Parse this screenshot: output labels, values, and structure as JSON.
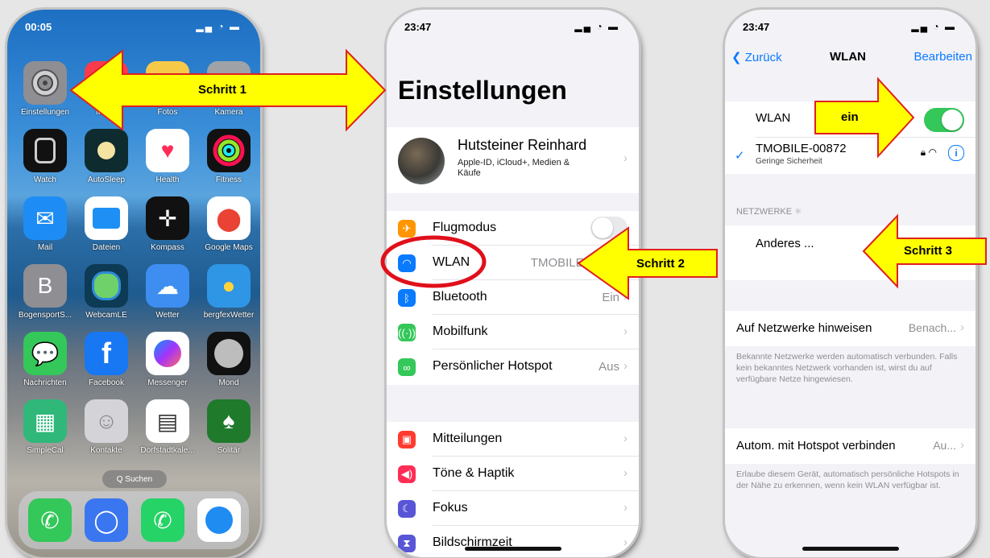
{
  "home": {
    "time": "00:05",
    "apps": [
      {
        "label": "Einstellungen",
        "icon": "settings-icon",
        "color": "#8e8e93"
      },
      {
        "label": "Musik",
        "icon": "music-icon",
        "color": "#fa3b4d"
      },
      {
        "label": "Fotos",
        "icon": "photos-icon",
        "color": "#f7c948"
      },
      {
        "label": "Kamera",
        "icon": "camera-icon",
        "color": "#9fa3a8"
      },
      {
        "label": "Watch",
        "icon": "watch-icon",
        "color": "#111111"
      },
      {
        "label": "AutoSleep",
        "icon": "autosleep-icon",
        "color": "#0e2c30"
      },
      {
        "label": "Health",
        "icon": "health-icon",
        "color": "#ffffff"
      },
      {
        "label": "Fitness",
        "icon": "fitness-icon",
        "color": "#111111"
      },
      {
        "label": "Mail",
        "icon": "mail-icon",
        "color": "#1d8df5"
      },
      {
        "label": "Dateien",
        "icon": "files-icon",
        "color": "#ffffff"
      },
      {
        "label": "Kompass",
        "icon": "compass-icon",
        "color": "#111111"
      },
      {
        "label": "Google Maps",
        "icon": "google-maps-icon",
        "color": "#ffffff"
      },
      {
        "label": "BogensportS...",
        "icon": "bogensport-icon",
        "color": "#8e8e93"
      },
      {
        "label": "WebcamLE",
        "icon": "webcam-icon",
        "color": "#0d3a54"
      },
      {
        "label": "Wetter",
        "icon": "weather-icon",
        "color": "#3d8ef0"
      },
      {
        "label": "bergfexWetter",
        "icon": "bergfex-weather-icon",
        "color": "#2f95e5"
      },
      {
        "label": "Nachrichten",
        "icon": "messages-icon",
        "color": "#34c759"
      },
      {
        "label": "Facebook",
        "icon": "facebook-icon",
        "color": "#1877f2"
      },
      {
        "label": "Messenger",
        "icon": "messenger-icon",
        "color": "#ffffff"
      },
      {
        "label": "Mond",
        "icon": "moon-icon",
        "color": "#111111"
      },
      {
        "label": "SimpleCal",
        "icon": "calendar-icon",
        "color": "#2fb87a"
      },
      {
        "label": "Kontakte",
        "icon": "contacts-icon",
        "color": "#d4d4d8"
      },
      {
        "label": "Dorfstadtkale...",
        "icon": "notes-icon",
        "color": "#ffffff"
      },
      {
        "label": "Solitär",
        "icon": "solitaire-icon",
        "color": "#1f7a2c"
      }
    ],
    "search_label": "Q Suchen",
    "dock": [
      {
        "icon": "phone-icon",
        "color": "#34c759"
      },
      {
        "icon": "signal-icon",
        "color": "#3a76f0"
      },
      {
        "icon": "whatsapp-icon",
        "color": "#25d366"
      },
      {
        "icon": "safari-icon",
        "color": "#ffffff"
      }
    ]
  },
  "settings": {
    "time": "23:47",
    "title": "Einstellungen",
    "profile": {
      "name": "Hutsteiner Reinhard",
      "subtitle": "Apple-ID, iCloud+, Medien & Käufe"
    },
    "rows": [
      {
        "label": "Flugmodus",
        "value": "",
        "icon": "airplane-icon",
        "color": "#ff9500"
      },
      {
        "label": "WLAN",
        "value": "TMOBILE-0087",
        "icon": "wifi-icon",
        "color": "#0a7aff"
      },
      {
        "label": "Bluetooth",
        "value": "Ein",
        "icon": "bluetooth-icon",
        "color": "#0a7aff"
      },
      {
        "label": "Mobilfunk",
        "value": "",
        "icon": "cellular-icon",
        "color": "#34c759"
      },
      {
        "label": "Persönlicher Hotspot",
        "value": "Aus",
        "icon": "hotspot-icon",
        "color": "#34c759"
      },
      {
        "label": "Mitteilungen",
        "value": "",
        "icon": "notifications-icon",
        "color": "#ff3b30"
      },
      {
        "label": "Töne & Haptik",
        "value": "",
        "icon": "sounds-icon",
        "color": "#ff2d55"
      },
      {
        "label": "Fokus",
        "value": "",
        "icon": "focus-icon",
        "color": "#5856d6"
      },
      {
        "label": "Bildschirmzeit",
        "value": "",
        "icon": "screentime-icon",
        "color": "#5856d6"
      }
    ]
  },
  "wlan": {
    "time": "23:47",
    "back_label": "Zurück",
    "title": "WLAN",
    "edit_label": "Bearbeiten",
    "wlan_label": "WLAN",
    "network": {
      "name": "TMOBILE-00872",
      "security": "Geringe Sicherheit"
    },
    "networks_header": "NETZWERKE",
    "other_label": "Anderes ...",
    "notify": {
      "label": "Auf Netzwerke hinweisen",
      "value": "Benach..."
    },
    "notify_footer": "Bekannte Netzwerke werden automatisch verbunden. Falls kein bekanntes Netzwerk vorhanden ist, wirst du auf verfügbare Netze hingewiesen.",
    "hotspot": {
      "label": "Autom. mit Hotspot verbinden",
      "value": "Au..."
    },
    "hotspot_footer": "Erlaube diesem Gerät, automatisch persönliche Hotspots in der Nähe zu erkennen, wenn kein WLAN verfügbar ist."
  },
  "annotations": {
    "step1": "Schritt 1",
    "step2": "Schritt 2",
    "step3": "Schritt 3",
    "on": "ein",
    "arrow_fill": "#ffff00",
    "arrow_stroke": "#e02020",
    "circle_color": "#e0101b"
  }
}
